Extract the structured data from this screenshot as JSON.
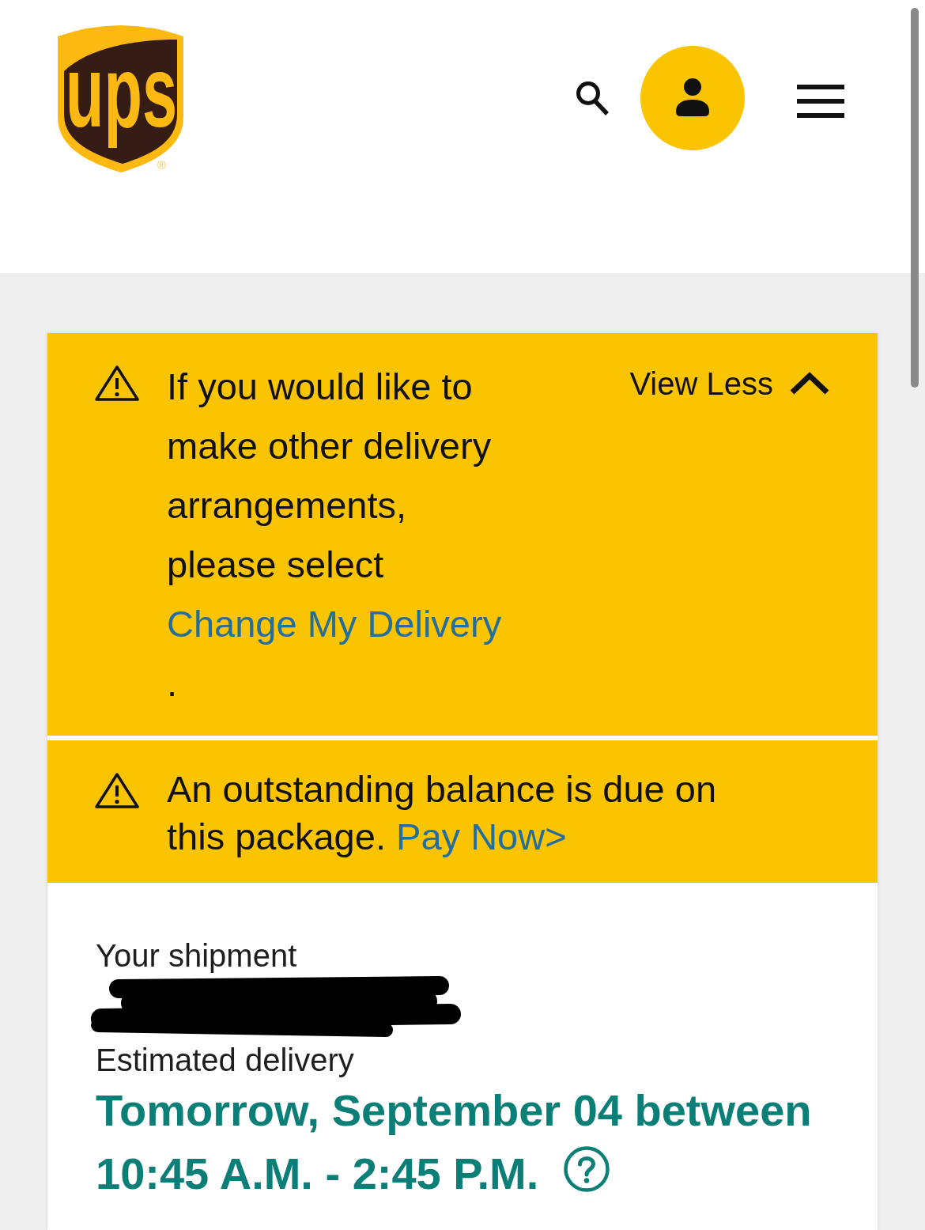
{
  "header": {
    "logo": {
      "wordmark": "ups",
      "registered_mark": "®"
    }
  },
  "alerts": [
    {
      "kind": "expandable",
      "message": "If you would like to make other delivery arrangements, please select",
      "link": "Change My Delivery",
      "trailing": ".",
      "toggle": {
        "label": "View Less",
        "expanded": true
      }
    },
    {
      "kind": "inline",
      "message": "An outstanding balance is due on this package.",
      "link": "Pay Now>"
    }
  ],
  "shipment": {
    "label": "Your shipment",
    "estimated_delivery": {
      "label": "Estimated delivery",
      "date": "Tomorrow, September 04 between",
      "window": "10:45 A.M. - 2:45 P.M."
    }
  }
}
